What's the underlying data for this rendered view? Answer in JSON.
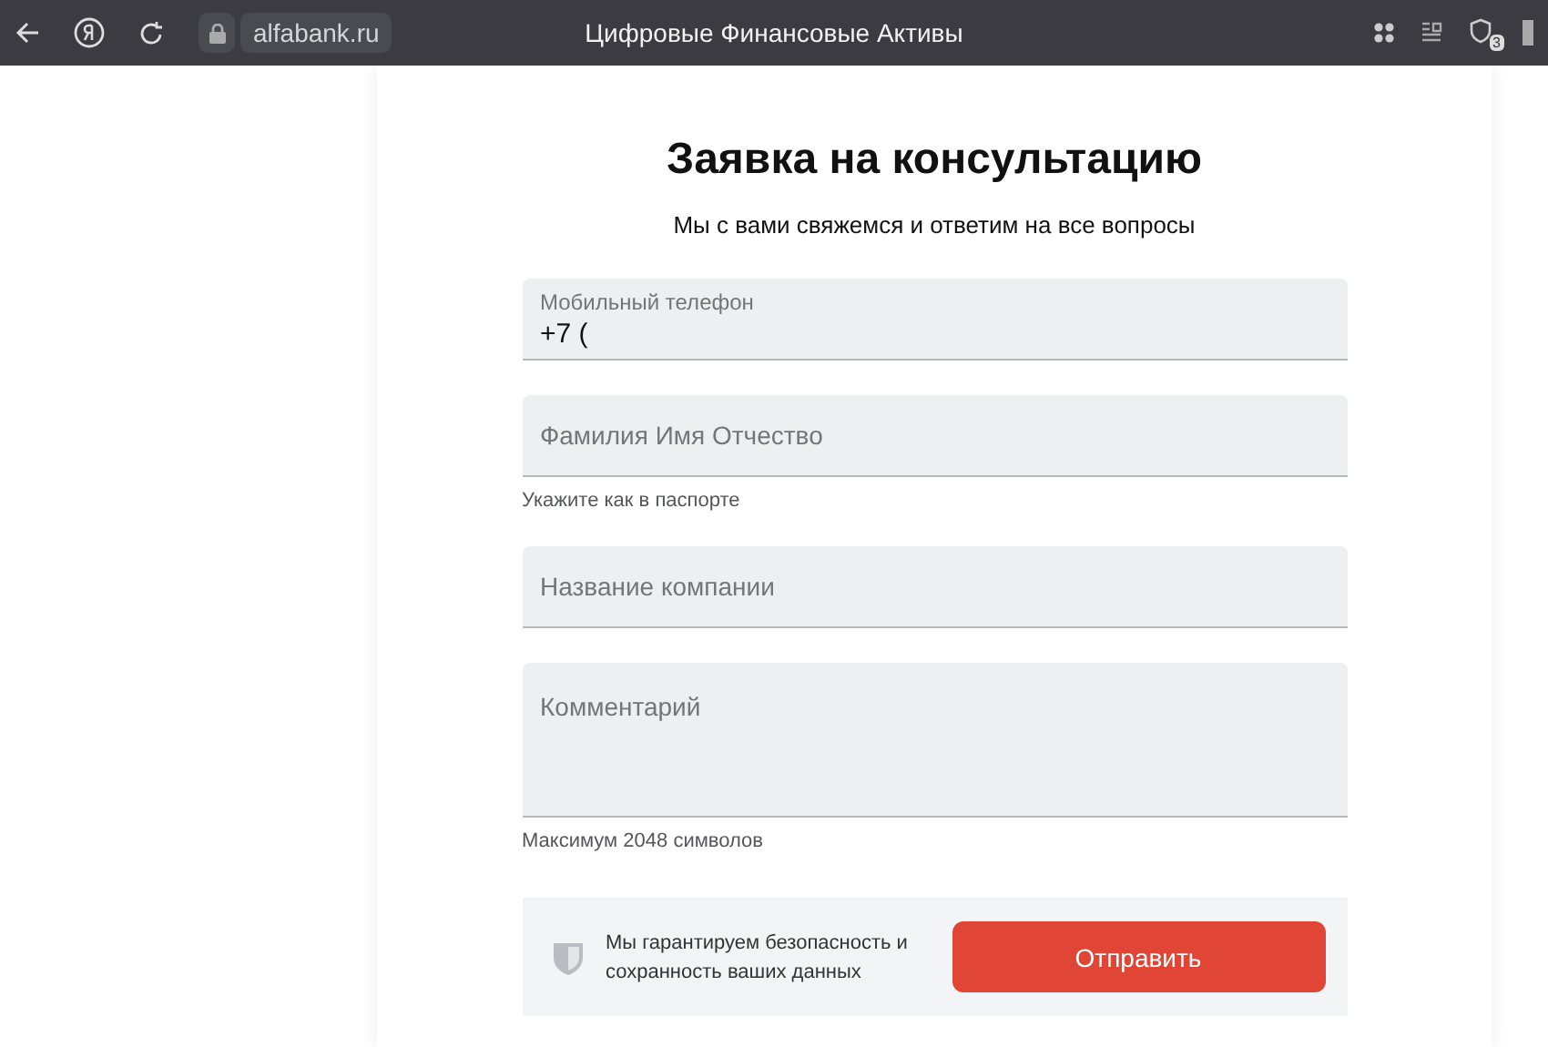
{
  "browser": {
    "url": "alfabank.ru",
    "title": "Цифровые Финансовые Активы",
    "badge": "3"
  },
  "form": {
    "title": "Заявка на консультацию",
    "subtitle": "Мы с вами свяжемся и ответим на все вопросы",
    "fields": [
      {
        "kind": "input",
        "label": "Мобильный телефон",
        "value": "+7 ("
      },
      {
        "kind": "input",
        "placeholder": "Фамилия Имя Отчество",
        "hint": "Укажите как в паспорте"
      },
      {
        "kind": "input",
        "placeholder": "Название компании"
      },
      {
        "kind": "textarea",
        "placeholder": "Комментарий",
        "hint": "Максимум 2048 символов"
      }
    ],
    "security_note": "Мы гарантируем безопасность и сохранность ваших данных",
    "submit": "Отправить"
  }
}
